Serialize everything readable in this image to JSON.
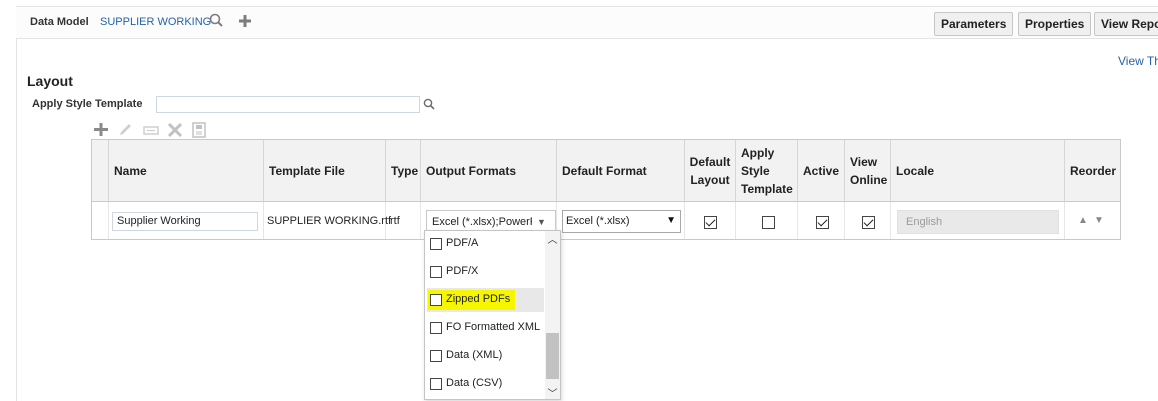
{
  "topbar": {
    "data_model_label": "Data Model",
    "data_model_name": "SUPPLIER WORKING",
    "buttons": [
      "Parameters",
      "Properties",
      "View Report"
    ]
  },
  "view_link": "View Th",
  "section": {
    "title": "Layout",
    "apply_style_template_label": "Apply Style Template",
    "apply_style_template_value": ""
  },
  "table": {
    "headers": {
      "name": "Name",
      "template_file": "Template File",
      "type": "Type",
      "output_formats": "Output Formats",
      "default_format": "Default Format",
      "default_layout": "Default\nLayout",
      "apply_style_template": "Apply\nStyle\nTemplate",
      "active": "Active",
      "view_online": "View\nOnline",
      "locale": "Locale",
      "reorder": "Reorder"
    },
    "row": {
      "name": "Supplier Working",
      "template_file": "SUPPLIER WORKING.rtf",
      "type": "rtf",
      "output_formats": "Excel (*.xlsx);PowerPoint",
      "default_format": "Excel (*.xlsx)",
      "default_layout": true,
      "apply_style_template": false,
      "active": true,
      "view_online": true,
      "locale": "English"
    }
  },
  "output_formats_dropdown": {
    "items": [
      {
        "label": "PDF/A",
        "checked": false
      },
      {
        "label": "PDF/X",
        "checked": false
      },
      {
        "label": "Zipped PDFs",
        "checked": false,
        "highlighted": true
      },
      {
        "label": "FO Formatted XML",
        "checked": false
      },
      {
        "label": "Data (XML)",
        "checked": false
      },
      {
        "label": "Data (CSV)",
        "checked": false
      }
    ],
    "highlight_color": "#f6f600"
  },
  "colors": {
    "link": "#2463a8",
    "header_bg": "#f2f2f2"
  }
}
